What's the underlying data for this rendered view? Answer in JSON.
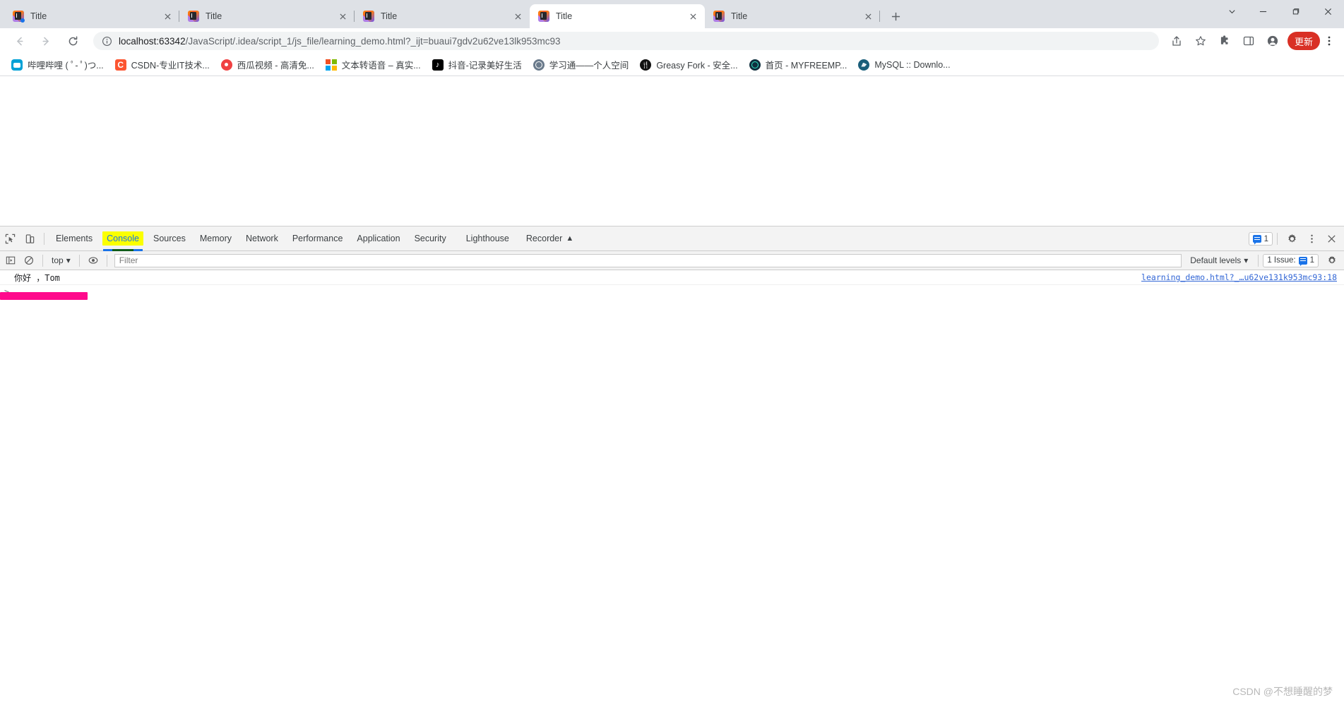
{
  "window": {
    "controls": {
      "chevron": "chevron-down",
      "minimize": "minimize",
      "maximize": "maximize",
      "close": "close"
    }
  },
  "tabs": [
    {
      "title": "Title",
      "active": false
    },
    {
      "title": "Title",
      "active": false
    },
    {
      "title": "Title",
      "active": false
    },
    {
      "title": "Title",
      "active": true
    },
    {
      "title": "Title",
      "active": false
    }
  ],
  "new_tab_label": "+",
  "toolbar": {
    "back_label": "Back",
    "forward_label": "Forward",
    "reload_label": "Reload",
    "url": "localhost:63342/JavaScript/.idea/script_1/js_file/learning_demo.html?_ijt=buaui7gdv2u62ve13lk953mc93",
    "url_host": "localhost:63342",
    "url_path": "/JavaScript/.idea/script_1/js_file/learning_demo.html?_ijt=buaui7gdv2u62ve13lk953mc93",
    "share_label": "Share",
    "bookmark_label": "Bookmark this tab",
    "extensions_label": "Extensions",
    "sidepanel_label": "Side panel",
    "profile_label": "Profile",
    "update_label": "更新",
    "menu_label": "Customize and control Google Chrome"
  },
  "bookmarks": [
    {
      "label": "哔哩哔哩 ( ﾟ- ﾟ)つ...",
      "icon": "bilibili-icon"
    },
    {
      "label": "CSDN-专业IT技术...",
      "icon": "csdn-icon"
    },
    {
      "label": "西瓜视频 - 高清免...",
      "icon": "xigua-icon"
    },
    {
      "label": "文本转语音 – 真实...",
      "icon": "microsoft-icon"
    },
    {
      "label": "抖音-记录美好生活",
      "icon": "douyin-icon"
    },
    {
      "label": "学习通——个人空间",
      "icon": "globe-icon"
    },
    {
      "label": "Greasy Fork - 安全...",
      "icon": "greasyfork-icon"
    },
    {
      "label": "首页 - MYFREEMP...",
      "icon": "teal-globe-icon"
    },
    {
      "label": "MySQL :: Downlo...",
      "icon": "mysql-icon"
    }
  ],
  "devtools": {
    "inspect_label": "Inspect element",
    "device_toolbar_label": "Toggle device toolbar",
    "tabs": [
      {
        "label": "Elements",
        "active": false,
        "highlighted": false
      },
      {
        "label": "Console",
        "active": true,
        "highlighted": true
      },
      {
        "label": "Sources",
        "active": false,
        "highlighted": false
      },
      {
        "label": "Memory",
        "active": false,
        "highlighted": false
      },
      {
        "label": "Network",
        "active": false,
        "highlighted": false
      },
      {
        "label": "Performance",
        "active": false,
        "highlighted": false
      },
      {
        "label": "Application",
        "active": false,
        "highlighted": false
      },
      {
        "label": "Security",
        "active": false,
        "highlighted": false
      },
      {
        "label": "Lighthouse",
        "active": false,
        "highlighted": false
      },
      {
        "label": "Recorder",
        "active": false,
        "highlighted": false,
        "suffix": "▲"
      }
    ],
    "issues_count": "1",
    "settings_label": "Settings",
    "more_label": "More options",
    "close_label": "Close DevTools"
  },
  "console": {
    "sidebar_toggle_label": "Show console sidebar",
    "clear_label": "Clear console",
    "context": "top",
    "live_expression_label": "Create live expression",
    "filter_placeholder": "Filter",
    "levels_label": "Default levels",
    "issues_pill_label": "1 Issue:",
    "issues_pill_count": "1",
    "messages": [
      {
        "text": "你好 ，Tom",
        "source": "learning_demo.html?_…u62ve131k953mc93:18"
      }
    ],
    "prompt_symbol": ">",
    "prompt_value": ""
  },
  "watermark": "CSDN @不想睡醒的梦",
  "colors": {
    "chrome_tabstrip": "#dee1e6",
    "accent_blue": "#1a73e8",
    "update_red": "#d93025",
    "highlight_yellow": "#fbff00",
    "annotation_pink": "#ff0a8c",
    "devtools_bg": "#f3f3f3"
  }
}
